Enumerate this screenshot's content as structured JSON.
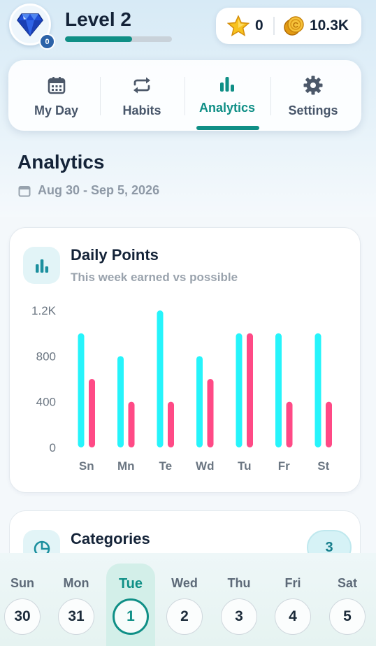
{
  "header": {
    "avatar_badge": "0",
    "level_label": "Level 2",
    "level_progress": 0.63,
    "stars_value": "0",
    "coins_value": "10.3K"
  },
  "nav": {
    "tabs": [
      {
        "label": "My Day",
        "icon": "calendar-icon",
        "active": false
      },
      {
        "label": "Habits",
        "icon": "repeat-icon",
        "active": false
      },
      {
        "label": "Analytics",
        "icon": "bar-chart-icon",
        "active": true
      },
      {
        "label": "Settings",
        "icon": "gear-icon",
        "active": false
      }
    ]
  },
  "page": {
    "title": "Analytics",
    "date_range": "Aug 30 - Sep 5, 2026"
  },
  "daily_points": {
    "title": "Daily Points",
    "subtitle": "This week earned vs possible"
  },
  "chart_data": {
    "type": "bar",
    "categories": [
      "Sn",
      "Mn",
      "Te",
      "Wd",
      "Tu",
      "Fr",
      "St"
    ],
    "series": [
      {
        "values": [
          1000,
          800,
          1200,
          800,
          1000,
          1000,
          1000
        ],
        "color": "#26f4fb"
      },
      {
        "values": [
          600,
          400,
          400,
          600,
          1000,
          400,
          400
        ],
        "color": "#ff4a86"
      }
    ],
    "ylim": [
      0,
      1200
    ],
    "yticks": [
      "0",
      "400",
      "800",
      "1.2K"
    ],
    "ytick_values": [
      0,
      400,
      800,
      1200
    ],
    "grid": false
  },
  "categories_card": {
    "title": "Categories",
    "count": "3"
  },
  "week": {
    "days": [
      {
        "name": "Sun",
        "date": "30",
        "today": false
      },
      {
        "name": "Mon",
        "date": "31",
        "today": false
      },
      {
        "name": "Tue",
        "date": "1",
        "today": true
      },
      {
        "name": "Wed",
        "date": "2",
        "today": false
      },
      {
        "name": "Thu",
        "date": "3",
        "today": false
      },
      {
        "name": "Fri",
        "date": "4",
        "today": false
      },
      {
        "name": "Sat",
        "date": "5",
        "today": false
      }
    ]
  },
  "colors": {
    "accent": "#0f8f86",
    "possible": "#26f4fb",
    "earned": "#ff4a86"
  }
}
